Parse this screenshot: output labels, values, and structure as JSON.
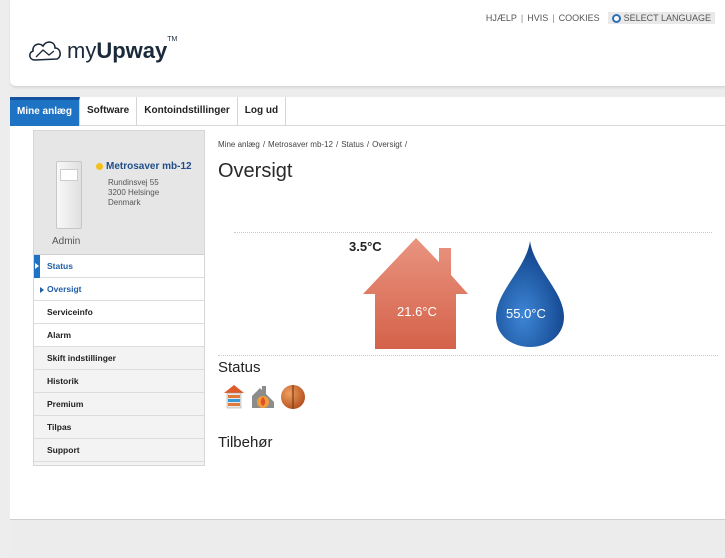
{
  "header": {
    "logo": {
      "prefix": "my",
      "brand": "Upway",
      "trademark": "TM"
    },
    "top_links": [
      "HJÆLP",
      "HVIS",
      "COOKIES"
    ],
    "language_button": "SELECT LANGUAGE"
  },
  "nav": {
    "tabs": [
      {
        "label": "Mine anlæg",
        "active": true
      },
      {
        "label": "Software",
        "active": false
      },
      {
        "label": "Kontoindstillinger",
        "active": false
      },
      {
        "label": "Log ud",
        "active": false
      }
    ]
  },
  "sidebar": {
    "device": {
      "name": "Metrosaver mb-12",
      "address_line1": "Rundinsvej 55",
      "address_line2": "3200 Helsinge",
      "address_line3": "Denmark",
      "role": "Admin",
      "status_color": "#f2c21a"
    },
    "menu": [
      {
        "label": "Status"
      },
      {
        "label": "Oversigt"
      },
      {
        "label": "Serviceinfo"
      },
      {
        "label": "Alarm"
      },
      {
        "label": "Skift indstillinger"
      },
      {
        "label": "Historik"
      },
      {
        "label": "Premium"
      },
      {
        "label": "Tilpas"
      },
      {
        "label": "Support"
      }
    ]
  },
  "main": {
    "breadcrumb": [
      "Mine anlæg",
      "Metrosaver mb-12",
      "Status",
      "Oversigt"
    ],
    "breadcrumb_sep": "/",
    "title": "Oversigt",
    "outdoor_temp": "3.5°C",
    "indoor_temp": "21.6°C",
    "hot_water_temp": "55.0°C",
    "status_heading": "Status",
    "status_icons": [
      "heating-radiator-icon",
      "compressor-flame-icon",
      "heat-pump-ball-icon"
    ],
    "accessories_heading": "Tilbehør"
  },
  "colors": {
    "accent_blue": "#1f73c5",
    "house": "#e07a5f",
    "water_drop": "#1d5fb3"
  }
}
